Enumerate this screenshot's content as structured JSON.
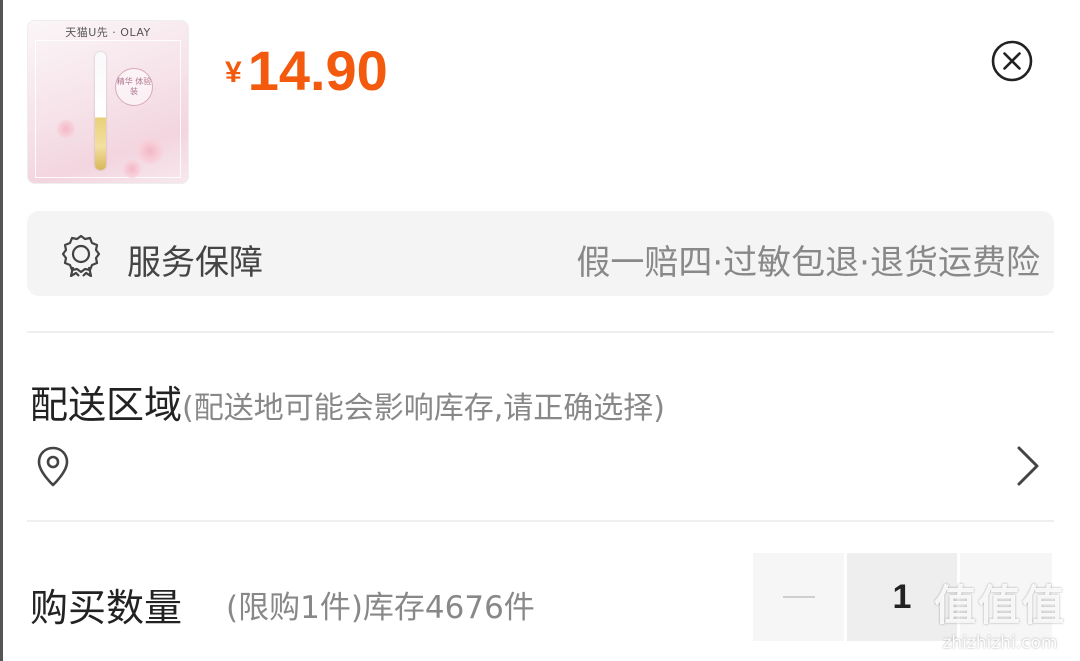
{
  "product": {
    "brand_text": "天猫U先 · OLAY",
    "badge_text": "精华 体验装",
    "currency": "¥",
    "price": "14.90",
    "price_color": "#f35a0d"
  },
  "close": {
    "icon": "close-circle-icon"
  },
  "service": {
    "icon": "badge-ribbon-icon",
    "title": "服务保障",
    "value": "假一赔四·过敏包退·退货运费险"
  },
  "delivery": {
    "title": "配送区域",
    "hint": "(配送地可能会影响库存,请正确选择)",
    "location_icon": "location-pin-icon",
    "chevron_icon": "chevron-right-icon"
  },
  "quantity": {
    "title": "购买数量",
    "hint": "(限购1件)库存4676件",
    "value": "1"
  },
  "watermark": {
    "glyph": "值值值",
    "url": "zhizhizhi.com"
  }
}
